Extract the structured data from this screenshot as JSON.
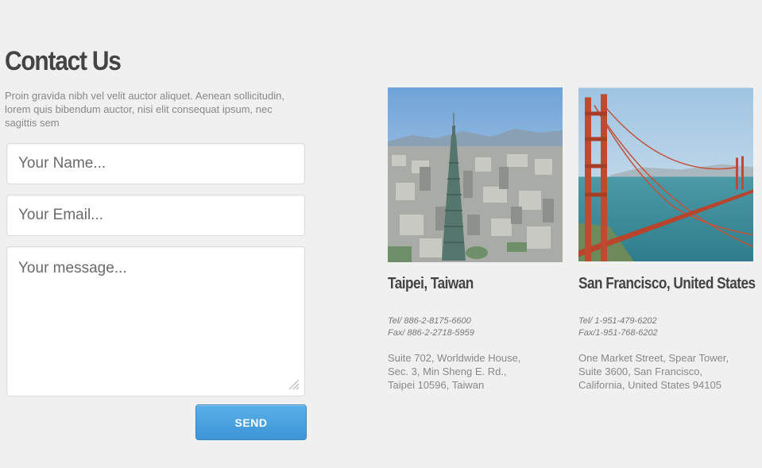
{
  "contact": {
    "title": "Contact Us",
    "intro": "Proin gravida nibh vel velit auctor aliquet. Aenean sollicitudin, lorem quis bibendum auctor, nisi elit consequat ipsum, nec sagittis sem"
  },
  "form": {
    "name_placeholder": "Your Name...",
    "email_placeholder": "Your Email...",
    "message_placeholder": "Your message...",
    "send_label": "SEND"
  },
  "offices": [
    {
      "city": "Taipei, Taiwan",
      "tel": "Tel/ 886-2-8175-6600",
      "fax": "Fax/ 886-2-2718-5959",
      "address": [
        "Suite 702, Worldwide House,",
        "Sec. 3, Min Sheng E. Rd.,",
        "Taipei 10596, Taiwan"
      ]
    },
    {
      "city": "San Francisco, United States",
      "tel": "Tel/ 1-951-479-6202",
      "fax": "Fax/1-951-768-6202",
      "address": [
        "One Market Street, Spear Tower,",
        "Suite 3600, San Francisco,",
        "California, United States 94105"
      ]
    }
  ],
  "colors": {
    "background": "#f0f0f0",
    "accent": "#4aa3e0",
    "heading": "#444444"
  }
}
